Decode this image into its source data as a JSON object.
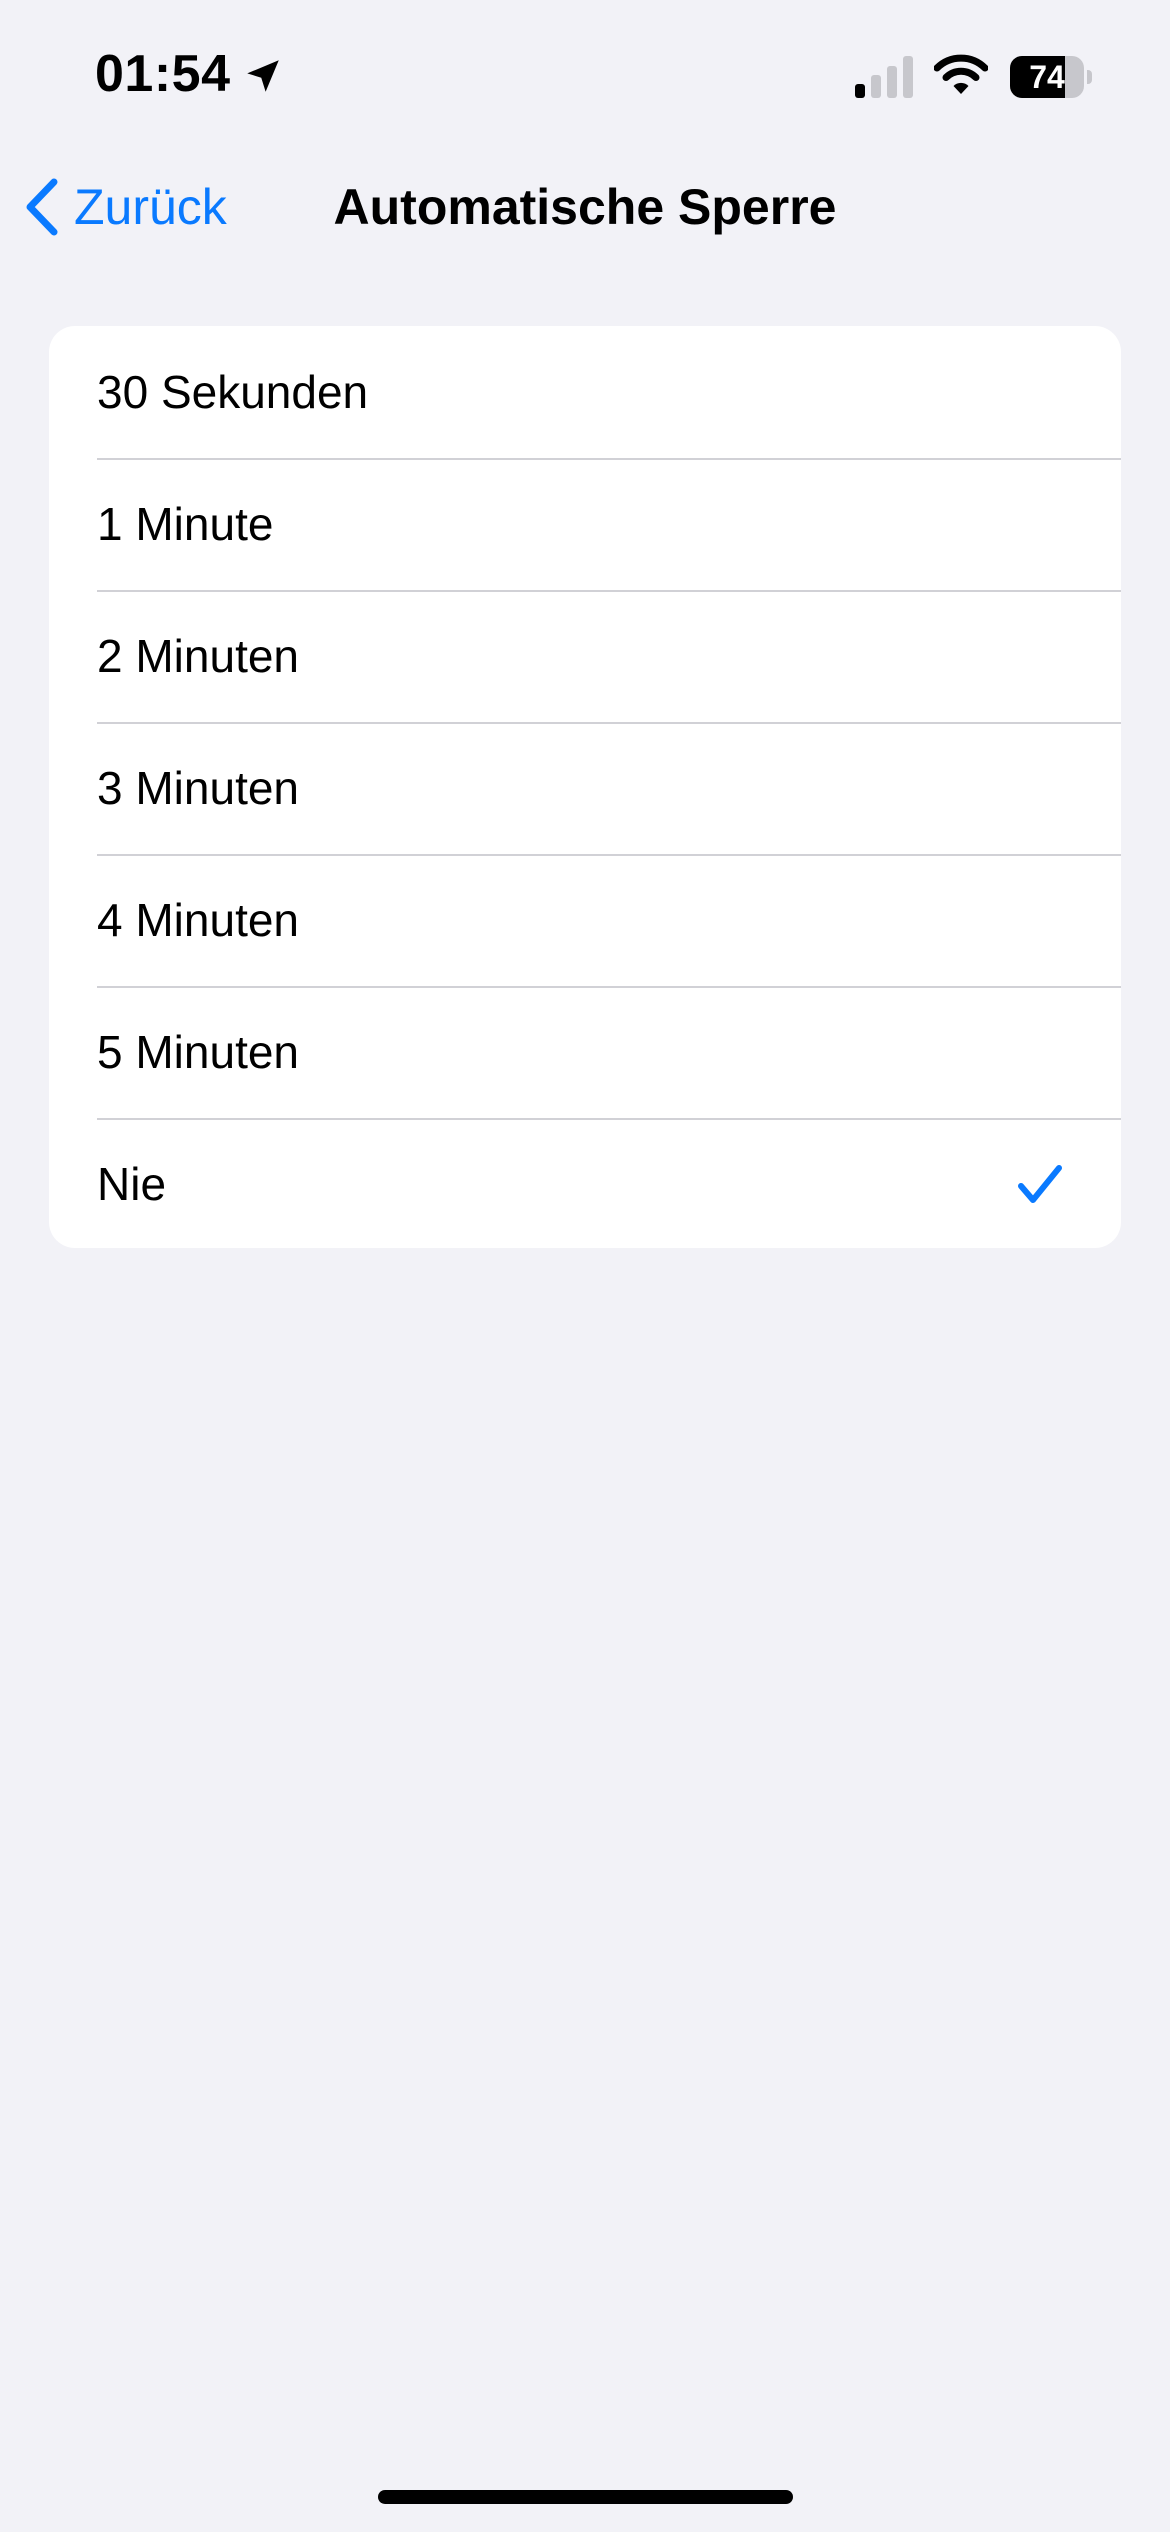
{
  "status_bar": {
    "time": "01:54",
    "location_icon": "location-arrow-icon",
    "signal_icon": "cellular-signal-icon",
    "signal_bars_active": 1,
    "signal_bars_total": 4,
    "wifi_icon": "wifi-icon",
    "battery_level": 74,
    "battery_label": "74"
  },
  "nav": {
    "back_icon": "chevron-left-icon",
    "back_label": "Zurück",
    "title": "Automatische Sperre"
  },
  "options": [
    {
      "label": "30 Sekunden",
      "selected": false
    },
    {
      "label": "1 Minute",
      "selected": false
    },
    {
      "label": "2 Minuten",
      "selected": false
    },
    {
      "label": "3 Minuten",
      "selected": false
    },
    {
      "label": "4 Minuten",
      "selected": false
    },
    {
      "label": "5 Minuten",
      "selected": false
    },
    {
      "label": "Nie",
      "selected": true
    }
  ],
  "selected_indicator_icon": "checkmark-icon",
  "colors": {
    "background": "#F2F2F7",
    "card": "#FFFFFF",
    "accent": "#0A7AFF",
    "separator": "#D1D1D6",
    "inactive_signal": "#C7C7CC"
  }
}
